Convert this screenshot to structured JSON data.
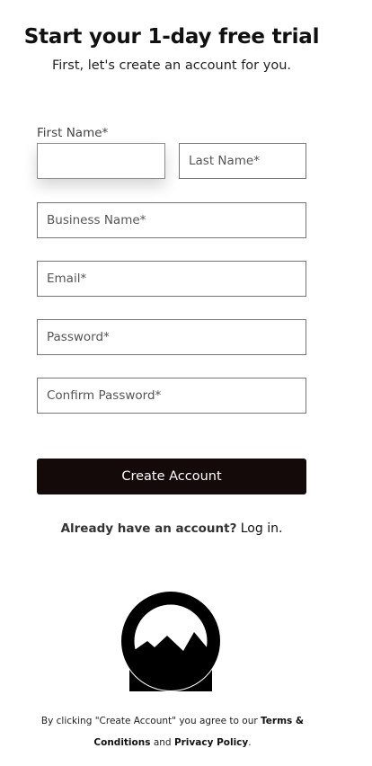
{
  "header": {
    "title": "Start your 1-day free trial",
    "subtitle": "First, let's create an account for you."
  },
  "form": {
    "first_name_label": "First Name*",
    "first_name_value": "",
    "last_name_placeholder": "Last Name*",
    "business_name_placeholder": "Business Name*",
    "email_placeholder": "Email*",
    "password_placeholder": "Password*",
    "confirm_password_placeholder": "Confirm Password*",
    "submit_label": "Create Account"
  },
  "login": {
    "prompt": "Already have an account?",
    "link_label": "Log in."
  },
  "logo": {
    "icon": "mountain-logo-icon"
  },
  "legal": {
    "prefix": "By clicking \"Create Account\" you agree to our",
    "terms_label": "Terms & Conditions",
    "and": "and",
    "privacy_label": "Privacy Policy",
    "suffix": "."
  },
  "colors": {
    "button_bg": "#140a0a",
    "field_border": "#767676",
    "text": "#111111"
  }
}
